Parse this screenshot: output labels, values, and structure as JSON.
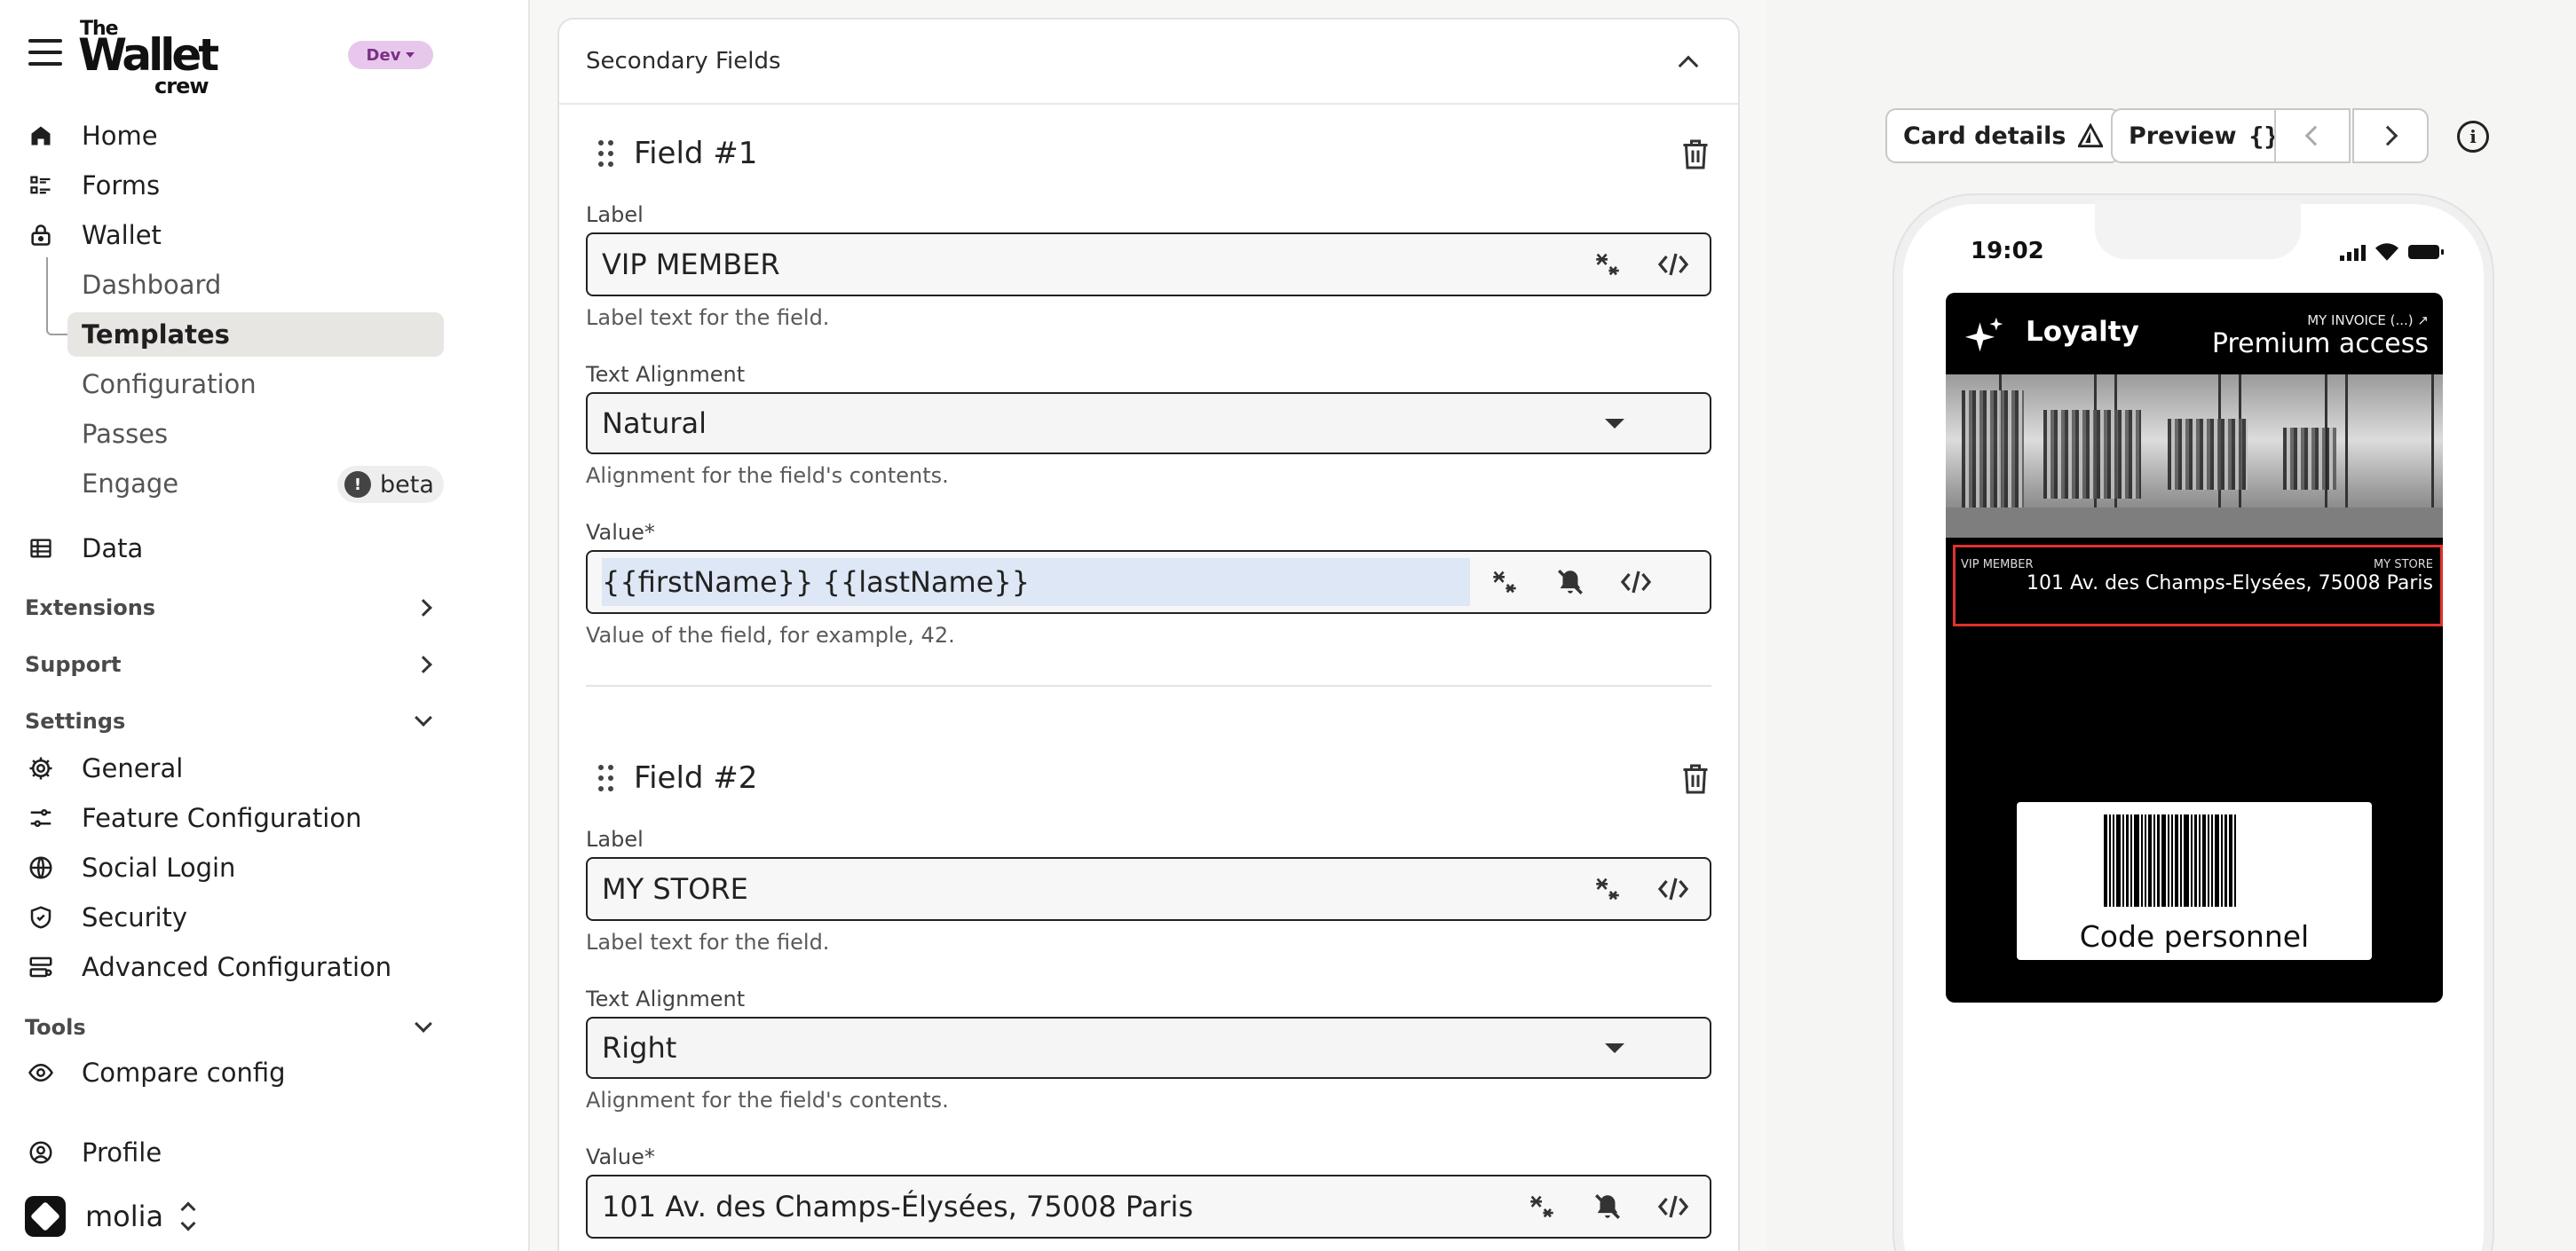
{
  "sidebar": {
    "logo": {
      "the": "The",
      "wallet": "Wallet",
      "crew": "crew"
    },
    "env": "Dev",
    "nav": {
      "home": "Home",
      "forms": "Forms",
      "wallet": "Wallet",
      "dashboard": "Dashboard",
      "templates": "Templates",
      "configuration": "Configuration",
      "passes": "Passes",
      "engage": "Engage",
      "beta": "beta",
      "data": "Data"
    },
    "sections": {
      "extensions": "Extensions",
      "support": "Support",
      "settings": "Settings",
      "tools": "Tools"
    },
    "settings_items": {
      "general": "General",
      "feature_configuration": "Feature Configuration",
      "social_login": "Social Login",
      "security": "Security",
      "advanced_configuration": "Advanced Configuration"
    },
    "tools_items": {
      "compare_config": "Compare config"
    },
    "profile": "Profile",
    "organization": "molia"
  },
  "form": {
    "section_title": "Secondary Fields",
    "fields": [
      {
        "title": "Field #1",
        "label_caption": "Label",
        "label_value": "VIP MEMBER",
        "label_help": "Label text for the field.",
        "alignment_caption": "Text Alignment",
        "alignment_value": "Natural",
        "alignment_help": "Alignment for the field's contents.",
        "value_caption": "Value",
        "value_required": "*",
        "value_value": "{{firstName}} {{lastName}}",
        "value_help": "Value of the field, for example, 42."
      },
      {
        "title": "Field #2",
        "label_caption": "Label",
        "label_value": "MY STORE",
        "label_help": "Label text for the field.",
        "alignment_caption": "Text Alignment",
        "alignment_value": "Right",
        "alignment_help": "Alignment for the field's contents.",
        "value_caption": "Value",
        "value_required": "*",
        "value_value": "101 Av. des Champs-Élysées, 75008 Paris"
      }
    ]
  },
  "preview": {
    "card_details_label": "Card details",
    "preview_label": "Preview",
    "info_glyph": "i",
    "status_time": "19:02",
    "pass": {
      "program": "Loyalty",
      "header_label": "MY INVOICE (...) ↗",
      "header_value": "Premium access",
      "secondary": {
        "left_label": "VIP MEMBER",
        "right_label": "MY STORE",
        "right_value": "101 Av. des Champs-Elysées, 75008 Paris"
      },
      "barcode_alt": "Code personnel"
    },
    "colors": {
      "pass_background": "#000000",
      "highlight_border": "#e0322b",
      "env_badge": "#e7c8ec"
    }
  }
}
